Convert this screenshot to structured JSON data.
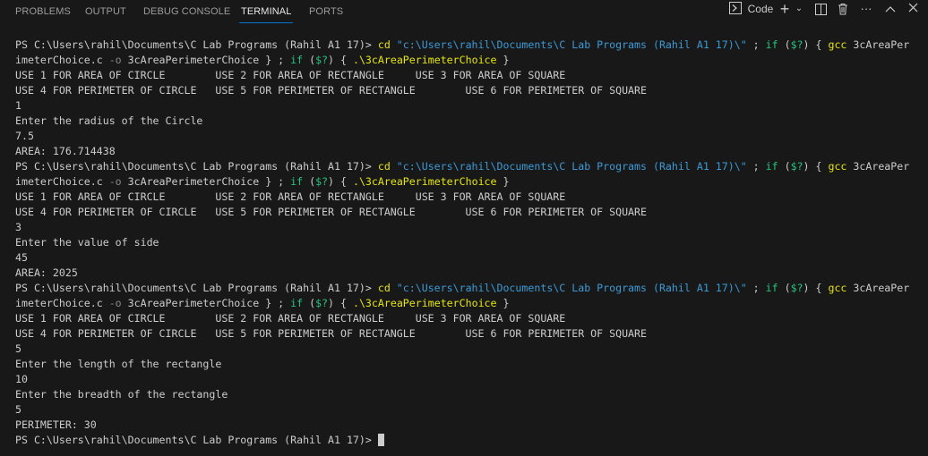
{
  "panel": {
    "tabs": [
      {
        "label": "PROBLEMS"
      },
      {
        "label": "OUTPUT"
      },
      {
        "label": "DEBUG CONSOLE"
      },
      {
        "label": "TERMINAL",
        "active": true
      },
      {
        "label": "PORTS"
      }
    ],
    "terminal_name": "Code",
    "colors": {
      "accent": "#0078d4",
      "background": "#181818",
      "text": "#cccccc",
      "command": "#e5e510",
      "string": "#3b9ad6",
      "keyword": "#23c57f",
      "parameter": "#8a8a8a"
    }
  },
  "terminal": {
    "lines": [
      [
        {
          "t": "PS C:\\Users\\rahil\\Documents\\C Lab Programs (Rahil A1 17)> ",
          "c": "d"
        },
        {
          "t": "cd",
          "c": "y"
        },
        {
          "t": " \"c:\\Users\\rahil\\Documents\\C Lab Programs (Rahil A1 17)\\\"",
          "c": "s"
        },
        {
          "t": " ; ",
          "c": "d"
        },
        {
          "t": "if",
          "c": "g"
        },
        {
          "t": " (",
          "c": "d"
        },
        {
          "t": "$?",
          "c": "g"
        },
        {
          "t": ") { ",
          "c": "d"
        },
        {
          "t": "gcc",
          "c": "y"
        },
        {
          "t": " 3cAreaPer",
          "c": "d"
        }
      ],
      [
        {
          "t": "imeterChoice.c ",
          "c": "d"
        },
        {
          "t": "-o",
          "c": "m"
        },
        {
          "t": " 3cAreaPerimeterChoice } ; ",
          "c": "d"
        },
        {
          "t": "if",
          "c": "g"
        },
        {
          "t": " (",
          "c": "d"
        },
        {
          "t": "$?",
          "c": "g"
        },
        {
          "t": ") { ",
          "c": "d"
        },
        {
          "t": ".\\3cAreaPerimeterChoice",
          "c": "y"
        },
        {
          "t": " }",
          "c": "d"
        }
      ],
      [
        {
          "t": "USE 1 FOR AREA OF CIRCLE        USE 2 FOR AREA OF RECTANGLE     USE 3 FOR AREA OF SQUARE",
          "c": "d"
        }
      ],
      [
        {
          "t": "USE 4 FOR PERIMETER OF CIRCLE   USE 5 FOR PERIMETER OF RECTANGLE        USE 6 FOR PERIMETER OF SQUARE",
          "c": "d"
        }
      ],
      [
        {
          "t": "1",
          "c": "d"
        }
      ],
      [
        {
          "t": "Enter the radius of the Circle",
          "c": "d"
        }
      ],
      [
        {
          "t": "7.5",
          "c": "d"
        }
      ],
      [
        {
          "t": "AREA: 176.714438",
          "c": "d"
        }
      ],
      [
        {
          "t": "PS C:\\Users\\rahil\\Documents\\C Lab Programs (Rahil A1 17)> ",
          "c": "d"
        },
        {
          "t": "cd",
          "c": "y"
        },
        {
          "t": " \"c:\\Users\\rahil\\Documents\\C Lab Programs (Rahil A1 17)\\\"",
          "c": "s"
        },
        {
          "t": " ; ",
          "c": "d"
        },
        {
          "t": "if",
          "c": "g"
        },
        {
          "t": " (",
          "c": "d"
        },
        {
          "t": "$?",
          "c": "g"
        },
        {
          "t": ") { ",
          "c": "d"
        },
        {
          "t": "gcc",
          "c": "y"
        },
        {
          "t": " 3cAreaPer",
          "c": "d"
        }
      ],
      [
        {
          "t": "imeterChoice.c ",
          "c": "d"
        },
        {
          "t": "-o",
          "c": "m"
        },
        {
          "t": " 3cAreaPerimeterChoice } ; ",
          "c": "d"
        },
        {
          "t": "if",
          "c": "g"
        },
        {
          "t": " (",
          "c": "d"
        },
        {
          "t": "$?",
          "c": "g"
        },
        {
          "t": ") { ",
          "c": "d"
        },
        {
          "t": ".\\3cAreaPerimeterChoice",
          "c": "y"
        },
        {
          "t": " }",
          "c": "d"
        }
      ],
      [
        {
          "t": "USE 1 FOR AREA OF CIRCLE        USE 2 FOR AREA OF RECTANGLE     USE 3 FOR AREA OF SQUARE",
          "c": "d"
        }
      ],
      [
        {
          "t": "USE 4 FOR PERIMETER OF CIRCLE   USE 5 FOR PERIMETER OF RECTANGLE        USE 6 FOR PERIMETER OF SQUARE",
          "c": "d"
        }
      ],
      [
        {
          "t": "3",
          "c": "d"
        }
      ],
      [
        {
          "t": "Enter the value of side",
          "c": "d"
        }
      ],
      [
        {
          "t": "45",
          "c": "d"
        }
      ],
      [
        {
          "t": "AREA: 2025",
          "c": "d"
        }
      ],
      [
        {
          "t": "PS C:\\Users\\rahil\\Documents\\C Lab Programs (Rahil A1 17)> ",
          "c": "d"
        },
        {
          "t": "cd",
          "c": "y"
        },
        {
          "t": " \"c:\\Users\\rahil\\Documents\\C Lab Programs (Rahil A1 17)\\\"",
          "c": "s"
        },
        {
          "t": " ; ",
          "c": "d"
        },
        {
          "t": "if",
          "c": "g"
        },
        {
          "t": " (",
          "c": "d"
        },
        {
          "t": "$?",
          "c": "g"
        },
        {
          "t": ") { ",
          "c": "d"
        },
        {
          "t": "gcc",
          "c": "y"
        },
        {
          "t": " 3cAreaPer",
          "c": "d"
        }
      ],
      [
        {
          "t": "imeterChoice.c ",
          "c": "d"
        },
        {
          "t": "-o",
          "c": "m"
        },
        {
          "t": " 3cAreaPerimeterChoice } ; ",
          "c": "d"
        },
        {
          "t": "if",
          "c": "g"
        },
        {
          "t": " (",
          "c": "d"
        },
        {
          "t": "$?",
          "c": "g"
        },
        {
          "t": ") { ",
          "c": "d"
        },
        {
          "t": ".\\3cAreaPerimeterChoice",
          "c": "y"
        },
        {
          "t": " }",
          "c": "d"
        }
      ],
      [
        {
          "t": "USE 1 FOR AREA OF CIRCLE        USE 2 FOR AREA OF RECTANGLE     USE 3 FOR AREA OF SQUARE",
          "c": "d"
        }
      ],
      [
        {
          "t": "USE 4 FOR PERIMETER OF CIRCLE   USE 5 FOR PERIMETER OF RECTANGLE        USE 6 FOR PERIMETER OF SQUARE",
          "c": "d"
        }
      ],
      [
        {
          "t": "5",
          "c": "d"
        }
      ],
      [
        {
          "t": "Enter the length of the rectangle",
          "c": "d"
        }
      ],
      [
        {
          "t": "10",
          "c": "d"
        }
      ],
      [
        {
          "t": "Enter the breadth of the rectangle",
          "c": "d"
        }
      ],
      [
        {
          "t": "5",
          "c": "d"
        }
      ],
      [
        {
          "t": "PERIMETER: 30",
          "c": "d"
        }
      ],
      [
        {
          "t": "PS C:\\Users\\rahil\\Documents\\C Lab Programs (Rahil A1 17)> ",
          "c": "d"
        }
      ]
    ]
  }
}
